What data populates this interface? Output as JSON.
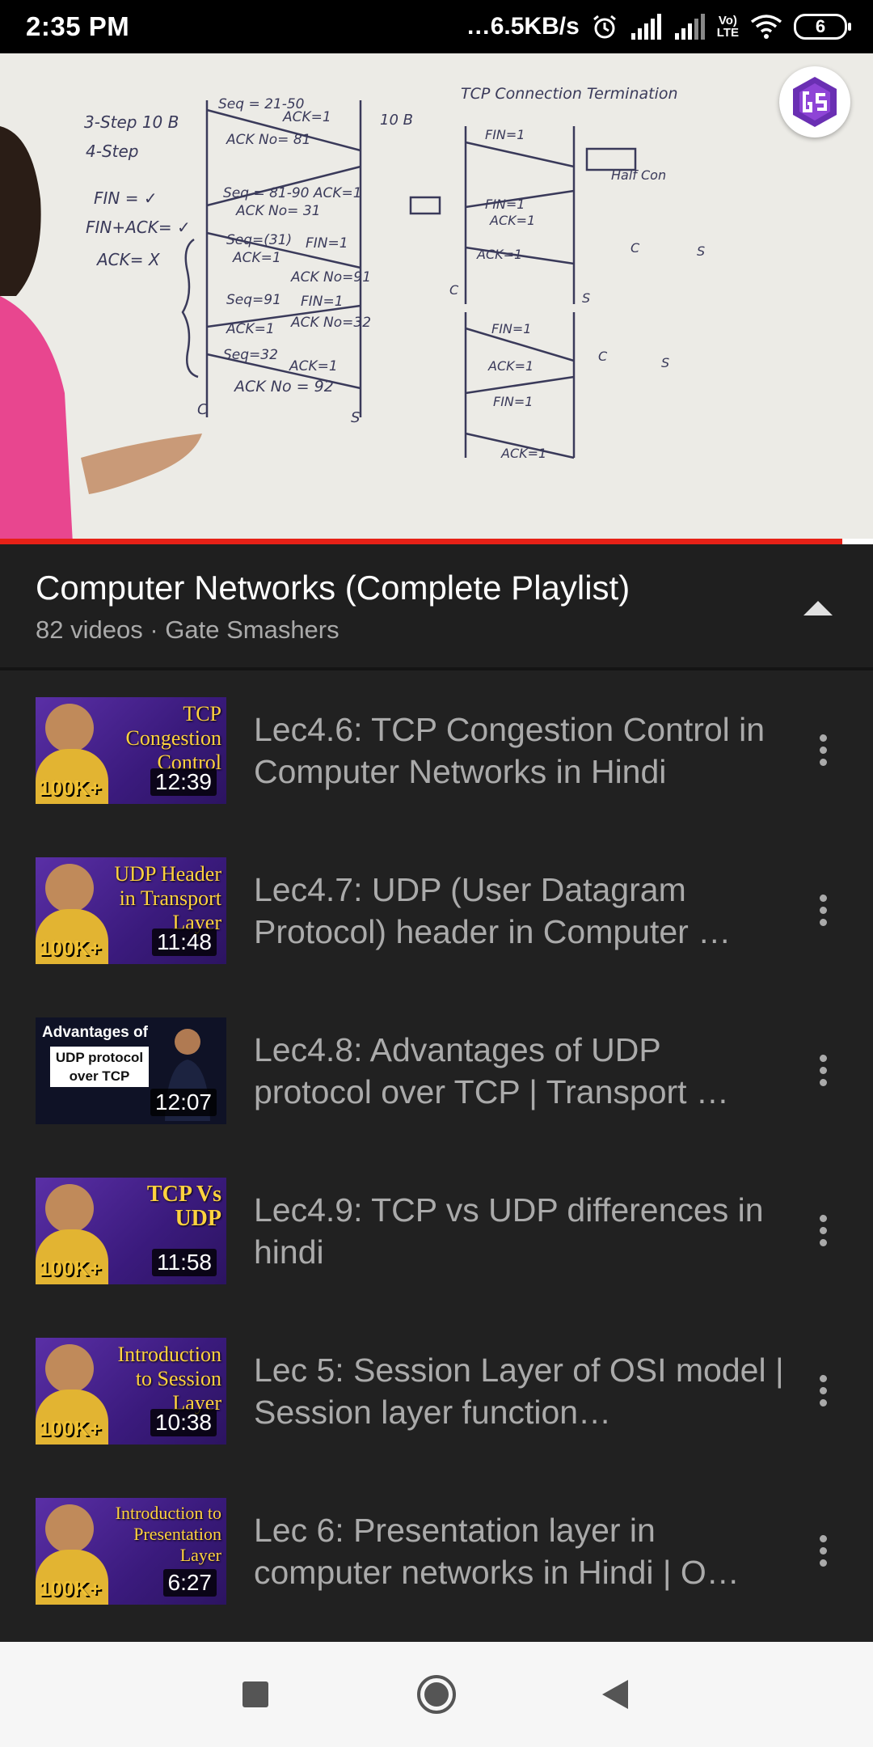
{
  "status_bar": {
    "time": "2:35 PM",
    "network_speed": "…6.5KB/s",
    "volte_top": "Vo)",
    "volte_bottom": "LTE",
    "battery": "6",
    "icons": [
      "alarm-icon",
      "signal-icon",
      "signal-icon",
      "volte-icon",
      "wifi-icon",
      "battery-icon"
    ]
  },
  "player": {
    "progress_fraction": 0.965,
    "board_text": {
      "left_notes": [
        "3-Step 10 B",
        "4-Step",
        "FIN = ✓",
        "FIN+ACK= ✓",
        "ACK= X"
      ],
      "heading": "TCP Connection Termination",
      "side_note": "Half Con",
      "diagram_labels": [
        "Seq = 21-50",
        "ACK=1",
        "ACK No= 81",
        "10 B",
        "Seq = 81-90 ACK=1",
        "ACK No= 31",
        "Seq=(31)",
        "FIN=1",
        "ACK=1",
        "ACK No=91",
        "Seq=91",
        "FIN=1",
        "ACK=1",
        "ACK No=32",
        "Seq=32",
        "ACK=1",
        "ACK No = 92",
        "C",
        "S",
        "FIN=1",
        "FIN=1",
        "ACK=1",
        "ACK=1",
        "C",
        "S",
        "FIN=1",
        "ACK=1",
        "FIN=1",
        "ACK=1",
        "C",
        "S",
        "C",
        "S"
      ]
    }
  },
  "playlist": {
    "title": "Computer Networks (Complete Playlist)",
    "meta": "82 videos · Gate Smashers",
    "items": [
      {
        "title": "Lec4.6: TCP Congestion Control in Computer Networks in Hindi",
        "duration": "12:39",
        "thumb_title": "TCP Congestion Control",
        "badge": "100K+"
      },
      {
        "title": "Lec4.7: UDP (User Datagram Protocol) header in Computer …",
        "duration": "11:48",
        "thumb_title": "UDP Header in Transport Layer",
        "badge": "100K+"
      },
      {
        "title": "Lec4.8: Advantages of UDP protocol over TCP | Transport …",
        "duration": "12:07",
        "thumb_top": "Advantages of",
        "thumb_box": "UDP protocol over TCP"
      },
      {
        "title": "Lec4.9: TCP vs UDP differences in hindi",
        "duration": "11:58",
        "thumb_title": "TCP Vs UDP",
        "badge": "100K+"
      },
      {
        "title": "Lec 5: Session Layer of OSI model | Session layer function…",
        "duration": "10:38",
        "thumb_title": "Introduction to Session Layer",
        "badge": "100K+"
      },
      {
        "title": "Lec 6: Presentation layer in computer networks in Hindi | O…",
        "duration": "6:27",
        "thumb_title": "Introduction to Presentation Layer",
        "badge": "100K+"
      }
    ]
  },
  "nav": {
    "buttons": [
      "recents-square-icon",
      "home-circle-icon",
      "back-triangle-icon"
    ]
  },
  "colors": {
    "background": "#212121",
    "progress": "#e62117",
    "secondary_text": "#aaaaaa"
  }
}
